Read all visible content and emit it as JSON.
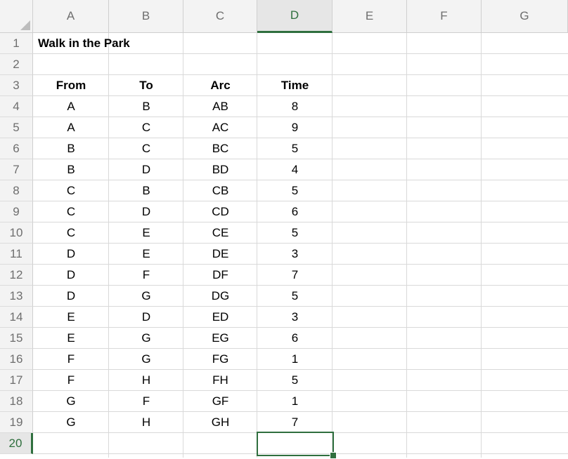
{
  "columns": [
    "A",
    "B",
    "C",
    "D",
    "E",
    "F",
    "G"
  ],
  "active_column": "D",
  "active_row": 20,
  "rows": [
    1,
    2,
    3,
    4,
    5,
    6,
    7,
    8,
    9,
    10,
    11,
    12,
    13,
    14,
    15,
    16,
    17,
    18,
    19,
    20
  ],
  "sheet": {
    "title": "Walk in the Park",
    "headers": {
      "from": "From",
      "to": "To",
      "arc": "Arc",
      "time": "Time"
    },
    "records": [
      {
        "from": "A",
        "to": "B",
        "arc": "AB",
        "time": "8"
      },
      {
        "from": "A",
        "to": "C",
        "arc": "AC",
        "time": "9"
      },
      {
        "from": "B",
        "to": "C",
        "arc": "BC",
        "time": "5"
      },
      {
        "from": "B",
        "to": "D",
        "arc": "BD",
        "time": "4"
      },
      {
        "from": "C",
        "to": "B",
        "arc": "CB",
        "time": "5"
      },
      {
        "from": "C",
        "to": "D",
        "arc": "CD",
        "time": "6"
      },
      {
        "from": "C",
        "to": "E",
        "arc": "CE",
        "time": "5"
      },
      {
        "from": "D",
        "to": "E",
        "arc": "DE",
        "time": "3"
      },
      {
        "from": "D",
        "to": "F",
        "arc": "DF",
        "time": "7"
      },
      {
        "from": "D",
        "to": "G",
        "arc": "DG",
        "time": "5"
      },
      {
        "from": "E",
        "to": "D",
        "arc": "ED",
        "time": "3"
      },
      {
        "from": "E",
        "to": "G",
        "arc": "EG",
        "time": "6"
      },
      {
        "from": "F",
        "to": "G",
        "arc": "FG",
        "time": "1"
      },
      {
        "from": "F",
        "to": "H",
        "arc": "FH",
        "time": "5"
      },
      {
        "from": "G",
        "to": "F",
        "arc": "GF",
        "time": "1"
      },
      {
        "from": "G",
        "to": "H",
        "arc": "GH",
        "time": "7"
      }
    ]
  },
  "colors": {
    "accent": "#2f6f3e",
    "header_bg": "#f3f3f3",
    "grid": "#d9d9d9"
  }
}
